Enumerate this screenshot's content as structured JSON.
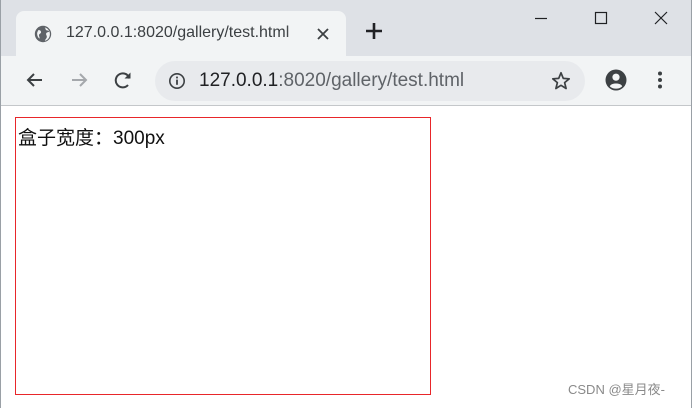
{
  "browser": {
    "tab": {
      "title": "127.0.0.1:8020/gallery/test.html",
      "favicon": "globe-icon",
      "close": "✕"
    },
    "new_tab": "plus-icon",
    "window_controls": [
      "minimize-icon",
      "maximize-icon",
      "close-icon"
    ],
    "toolbar": {
      "back": "arrow-left-icon",
      "forward": "arrow-right-icon",
      "reload": "reload-icon",
      "url_host": "127.0.0.1",
      "url_rest": ":8020/gallery/test.html",
      "info": "info-icon",
      "bookmark": "star-icon",
      "account": "account-icon",
      "menu": "more-vert-icon"
    }
  },
  "page": {
    "box_text": "盒子宽度：300px",
    "box_border_color": "#e8262a"
  },
  "watermark": "CSDN @星月夜-"
}
